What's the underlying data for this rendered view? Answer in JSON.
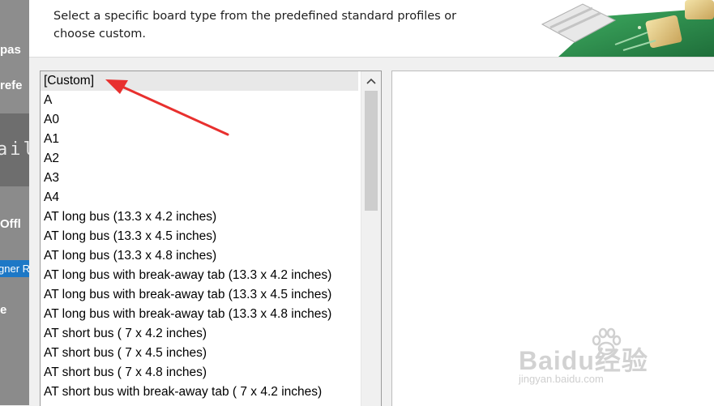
{
  "left_panel": {
    "fragments": [
      "pas",
      "refe",
      "ail",
      "Offl",
      "gner R",
      "e"
    ]
  },
  "header": {
    "instruction": "Select a specific board type from the predefined standard profiles or choose custom."
  },
  "board_list": {
    "selected_index": 0,
    "items": [
      "[Custom]",
      "A",
      "A0",
      "A1",
      "A2",
      "A3",
      "A4",
      "AT long bus (13.3 x 4.2 inches)",
      "AT long bus (13.3 x 4.5 inches)",
      "AT long bus (13.3 x 4.8 inches)",
      "AT long bus with break-away tab (13.3 x 4.2 inches)",
      "AT long bus with break-away tab (13.3 x 4.5 inches)",
      "AT long bus with break-away tab (13.3 x 4.8 inches)",
      "AT short bus ( 7 x 4.2 inches)",
      "AT short bus ( 7 x 4.5 inches)",
      "AT short bus ( 7 x 4.8 inches)",
      "AT short bus with break-away tab ( 7 x 4.2 inches)"
    ]
  },
  "scrollbar": {
    "up_glyph": "⌃"
  },
  "watermark": {
    "brand": "Baidu经验",
    "url": "jingyan.baidu.com"
  },
  "colors": {
    "annotation_arrow": "#e8302e",
    "selection_highlight": "#1d78c6",
    "pcb_green": "#2f8f4e"
  }
}
